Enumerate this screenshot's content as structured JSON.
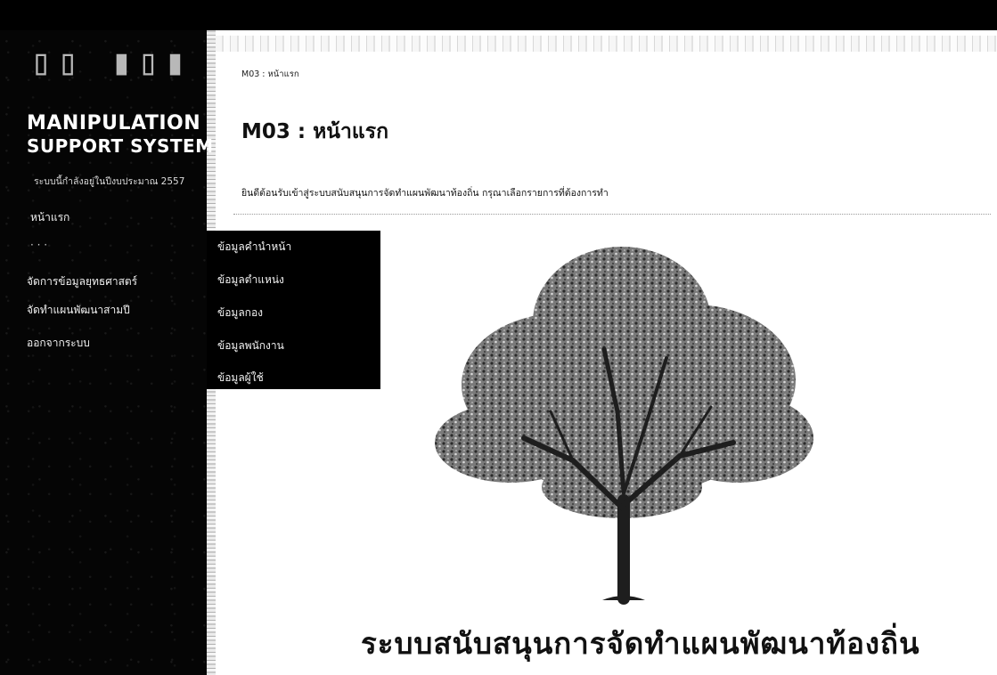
{
  "app": {
    "logo_line1": "MANIPULATION",
    "logo_line2": "SUPPORT SYSTEM",
    "tagline": "ระบบนี้กำลังอยู่ในปีงบประมาณ 2557"
  },
  "sidebar": {
    "items": [
      {
        "label": "หน้าแรก"
      },
      {
        "label": "จัดการข้อมูลยุทธศาสตร์"
      },
      {
        "label": "จัดทำแผนพัฒนาสามปี"
      },
      {
        "label": "ออกจากระบบ"
      }
    ]
  },
  "submenu": {
    "items": [
      {
        "label": "ข้อมูลคำนำหน้า"
      },
      {
        "label": "ข้อมูลตำแหน่ง"
      },
      {
        "label": "ข้อมูลกอง"
      },
      {
        "label": "ข้อมูลพนักงาน"
      },
      {
        "label": "ข้อมูลผู้ใช้"
      }
    ]
  },
  "main": {
    "breadcrumb": "M03 : หน้าแรก",
    "title": "M03 : หน้าแรก",
    "welcome": "ยินดีต้อนรับเข้าสู่ระบบสนับสนุนการจัดทำแผนพัฒนาท้องถิ่น กรุณาเลือกรายการที่ต้องการทำ",
    "system_name": "ระบบสนับสนุนการจัดทำแผนพัฒนาท้องถิ่น"
  },
  "colors": {
    "sidebar_bg": "#050505",
    "submenu_bg": "#000000",
    "text_light": "#f0f0f0",
    "text_dark": "#111111"
  },
  "icons": {
    "logo_pattern": "logo-glyph-pattern",
    "hero": "tree-illustration"
  }
}
